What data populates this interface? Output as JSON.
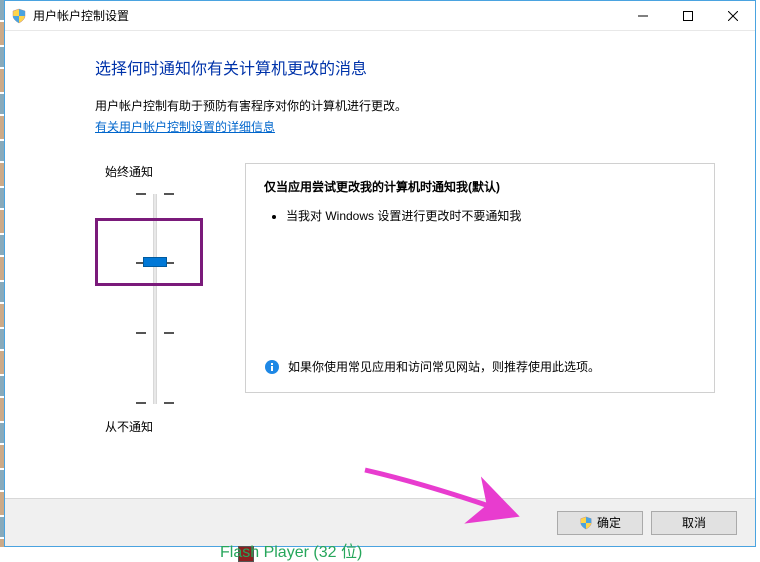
{
  "titlebar": {
    "title": "用户帐户控制设置"
  },
  "content": {
    "heading": "选择何时通知你有关计算机更改的消息",
    "desc": "用户帐户控制有助于预防有害程序对你的计算机进行更改。",
    "link": "有关用户帐户控制设置的详细信息"
  },
  "slider": {
    "topLabel": "始终通知",
    "bottomLabel": "从不通知"
  },
  "panel": {
    "title": "仅当应用尝试更改我的计算机时通知我(默认)",
    "bullets": [
      "当我对 Windows 设置进行更改时不要通知我"
    ],
    "recommend": "如果你使用常见应用和访问常见网站，则推荐使用此选项。"
  },
  "footer": {
    "ok": "确定",
    "cancel": "取消"
  },
  "bgText": "Flash Player (32 位)"
}
